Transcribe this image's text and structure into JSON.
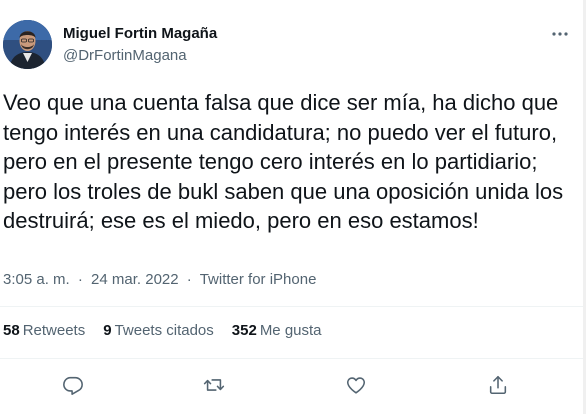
{
  "author": {
    "name": "Miguel Fortin Magaña",
    "handle": "@DrFortinMagana"
  },
  "tweet": {
    "text": "Veo que una cuenta falsa que dice ser mía, ha dicho que tengo interés en una candidatura; no puedo ver el futuro, pero en el presente tengo cero interés en lo partidiario; pero los troles de bukl saben que una oposición unida los destruirá; ese es el miedo, pero en eso estamos!",
    "time": "3:05 a. m.",
    "separator": "·",
    "date": "24 mar. 2022",
    "source": "Twitter for iPhone"
  },
  "stats": {
    "retweets_count": "58",
    "retweets_label": "Retweets",
    "quotes_count": "9",
    "quotes_label": "Tweets citados",
    "likes_count": "352",
    "likes_label": "Me gusta"
  },
  "icons": {
    "more": "more-dots-icon",
    "reply": "reply-icon",
    "retweet": "retweet-icon",
    "like": "heart-icon",
    "share": "share-icon"
  },
  "colors": {
    "text": "#0f1419",
    "secondary": "#536471",
    "divider": "#eff3f4"
  }
}
